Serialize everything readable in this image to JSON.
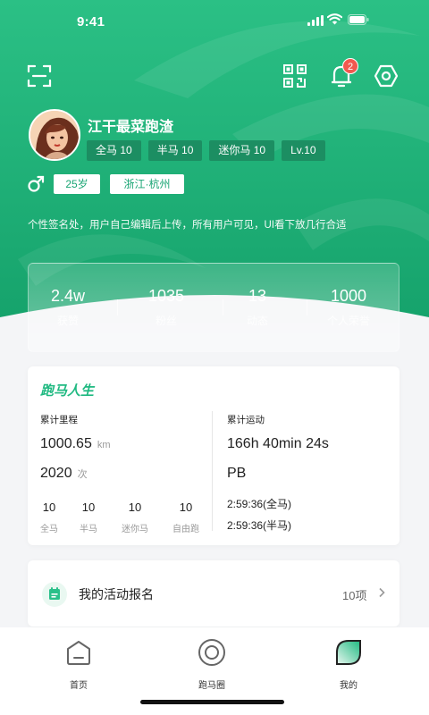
{
  "status_bar": {
    "time": "9:41"
  },
  "header": {
    "notification_count": "2"
  },
  "profile": {
    "username": "江干最菜跑渣",
    "tags": [
      "全马 10",
      "半马 10",
      "迷你马 10",
      "Lv.10"
    ],
    "age": "25岁",
    "location": "浙江·杭州",
    "bio": "个性签名处，用户自己编辑后上传，所有用户可见，UI看下放几行合适"
  },
  "stats": [
    {
      "value": "2.4w",
      "label": "获赞"
    },
    {
      "value": "1035",
      "label": "粉丝"
    },
    {
      "value": "13",
      "label": "动态"
    },
    {
      "value": "1000",
      "label": "个人荣誉"
    }
  ],
  "running_life": {
    "title": "跑马人生",
    "total_distance_label": "累计里程",
    "distance_value": "1000.65",
    "distance_unit": "km",
    "count_value": "2020",
    "count_unit": "次",
    "breakdown": [
      {
        "value": "10",
        "label": "全马"
      },
      {
        "value": "10",
        "label": "半马"
      },
      {
        "value": "10",
        "label": "迷你马"
      },
      {
        "value": "10",
        "label": "自由跑"
      }
    ],
    "total_time_label": "累计运动",
    "total_time_value": "166h 40min 24s",
    "pb_label": "PB",
    "pb_records": [
      "2:59:36(全马)",
      "2:59:36(半马)"
    ]
  },
  "activity": {
    "title": "我的活动报名",
    "count": "10项"
  },
  "tabbar": {
    "items": [
      "首页",
      "跑马圈",
      "我的"
    ]
  },
  "colors": {
    "brand": "#1fb981",
    "brand_dark": "#1c8e62",
    "badge": "#f2584f"
  }
}
